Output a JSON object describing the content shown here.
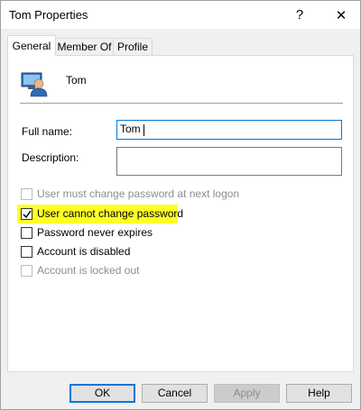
{
  "window": {
    "title": "Tom Properties",
    "help_glyph": "?",
    "close_glyph": "✕"
  },
  "tabs": [
    {
      "label": "General",
      "active": true
    },
    {
      "label": "Member Of",
      "active": false
    },
    {
      "label": "Profile",
      "active": false
    }
  ],
  "general": {
    "icon": "user-icon",
    "user_name": "Tom",
    "full_name_label": "Full name:",
    "full_name_value": "Tom",
    "description_label": "Description:",
    "description_value": "",
    "checkboxes": [
      {
        "label": "User must change password at next logon",
        "checked": false,
        "enabled": false
      },
      {
        "label": "User cannot change password",
        "checked": true,
        "enabled": true,
        "highlighted": true
      },
      {
        "label": "Password never expires",
        "checked": false,
        "enabled": true
      },
      {
        "label": "Account is disabled",
        "checked": false,
        "enabled": true
      },
      {
        "label": "Account is locked out",
        "checked": false,
        "enabled": false
      }
    ]
  },
  "buttons": {
    "ok": "OK",
    "cancel": "Cancel",
    "apply": "Apply",
    "help": "Help"
  },
  "colors": {
    "highlight": "#ffff26",
    "focus_border": "#0078d7"
  }
}
